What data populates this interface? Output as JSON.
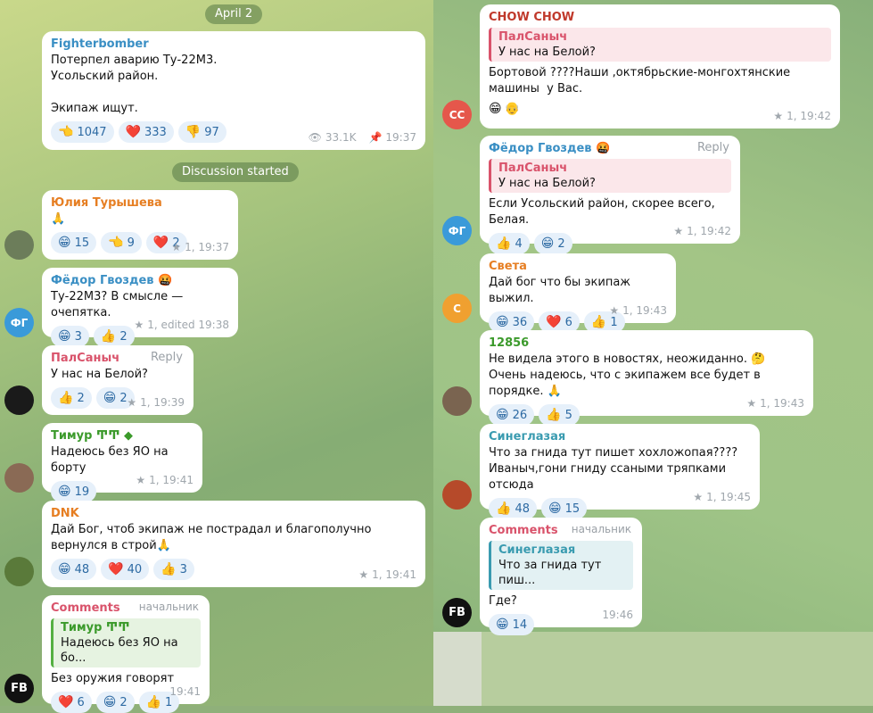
{
  "left": {
    "date_chip": "April 2",
    "post": {
      "author": "Fighterbomber",
      "text": "Потерпел аварию Ту-22М3.\nУсольский район.\n\nЭкипаж ищут.",
      "reactions": [
        {
          "emoji": "👈",
          "count": "1047"
        },
        {
          "emoji": "❤️",
          "count": "333"
        },
        {
          "emoji": "👎",
          "count": "97"
        }
      ],
      "views": "33.1K",
      "time": "19:37"
    },
    "discussion_chip": "Discussion started",
    "comments": [
      {
        "author": "Юлия Турышева",
        "color": "#e67e22",
        "text": "🙏",
        "reactions": [
          {
            "emoji": "😁",
            "count": "15"
          },
          {
            "emoji": "👈",
            "count": "9"
          },
          {
            "emoji": "❤️",
            "count": "2"
          }
        ],
        "meta": "1, 19:37",
        "avatar": "photo-women"
      },
      {
        "author": "Фёдор Гвоздев 🤬",
        "color": "#3a8fc4",
        "text": "Ту-22М3? В смысле — очепятка.",
        "reactions": [
          {
            "emoji": "😁",
            "count": "3"
          },
          {
            "emoji": "👍",
            "count": "2"
          }
        ],
        "meta": "1, edited 19:38",
        "avatar": "ФГ"
      },
      {
        "author": "ПалСаныч",
        "color": "#d9536b",
        "text": "У нас на Белой?",
        "reply_tag": "Reply",
        "reactions": [
          {
            "emoji": "👍",
            "count": "2"
          },
          {
            "emoji": "😁",
            "count": "2"
          }
        ],
        "meta": "1, 19:39",
        "avatar": "monster"
      },
      {
        "author": "Тимур ͲͲ ◆",
        "color": "#3b9a2b",
        "text": "Надеюсь без ЯО на борту",
        "reactions": [
          {
            "emoji": "😁",
            "count": "19"
          }
        ],
        "meta": "1, 19:41",
        "avatar": "photo-man"
      },
      {
        "author": "DNK",
        "color": "#e67e22",
        "text": "Дай Бог, чтоб экипаж не пострадал и благополучно вернулся в строй🙏",
        "reactions": [
          {
            "emoji": "😁",
            "count": "48"
          },
          {
            "emoji": "❤️",
            "count": "40"
          },
          {
            "emoji": "👍",
            "count": "3"
          }
        ],
        "meta": "1, 19:41",
        "avatar": "frog"
      },
      {
        "author": "Comments",
        "color": "#d9536b",
        "rank": "начальник",
        "quote": {
          "name": "Тимур ͲͲ",
          "text": "Надеюсь без ЯО на бо..."
        },
        "text": "Без оружия говорят",
        "reactions": [
          {
            "emoji": "❤️",
            "count": "6"
          },
          {
            "emoji": "😁",
            "count": "2"
          },
          {
            "emoji": "👍",
            "count": "1"
          }
        ],
        "meta": "19:41",
        "avatar": "FB"
      }
    ]
  },
  "right": {
    "comments": [
      {
        "author": "CHOW CHOW",
        "color": "#c0392b",
        "quote": {
          "name": "ПалСаныч",
          "text": "У нас на Белой?"
        },
        "text": "Бортовой ????Наши ,октябрьские-монгохтянские машины  у Вас.",
        "reactions": [
          {
            "emoji": "😁",
            "count": ""
          },
          {
            "emoji": "👴",
            "count": ""
          }
        ],
        "meta": "1, 19:42",
        "avatar": "CC"
      },
      {
        "author": "Фёдор Гвоздев 🤬",
        "color": "#3a8fc4",
        "reply_tag": "Reply",
        "quote": {
          "name": "ПалСаныч",
          "text": "У нас на Белой?"
        },
        "text": "Если Усольский район, скорее всего, Белая.",
        "reactions": [
          {
            "emoji": "👍",
            "count": "4"
          },
          {
            "emoji": "😁",
            "count": "2"
          }
        ],
        "meta": "1, 19:42",
        "avatar": "ФГ"
      },
      {
        "author": "Света",
        "color": "#e67e22",
        "text": "Дай бог что бы экипаж выжил.",
        "reactions": [
          {
            "emoji": "😁",
            "count": "36"
          },
          {
            "emoji": "❤️",
            "count": "6"
          },
          {
            "emoji": "👍",
            "count": "1"
          }
        ],
        "meta": "1, 19:43",
        "avatar": "С"
      },
      {
        "author": "12856",
        "color": "#3b9a2b",
        "text": "Не видела этого в новостях, неожиданно. 🤔\nОчень надеюсь, что с экипажем все будет в порядке. 🙏",
        "reactions": [
          {
            "emoji": "😁",
            "count": "26"
          },
          {
            "emoji": "👍",
            "count": "5"
          }
        ],
        "meta": "1, 19:43",
        "avatar": "photo-field"
      },
      {
        "author": "Синеглазая",
        "color": "#3a9bb0",
        "text": "Что за гнида тут пишет хохложопая????\nИваныч,гони гниду ссаными тряпками отсюда",
        "reactions": [
          {
            "emoji": "👍",
            "count": "48"
          },
          {
            "emoji": "😁",
            "count": "15"
          }
        ],
        "meta": "1, 19:45",
        "avatar": "photo-sunset"
      },
      {
        "author": "Comments",
        "color": "#d9536b",
        "rank": "начальник",
        "quote": {
          "name": "Синеглазая",
          "text": "Что за гнида тут пиш..."
        },
        "text": "Где?",
        "reactions": [
          {
            "emoji": "😁",
            "count": "14"
          }
        ],
        "meta": "19:46",
        "avatar": "FB"
      }
    ]
  }
}
